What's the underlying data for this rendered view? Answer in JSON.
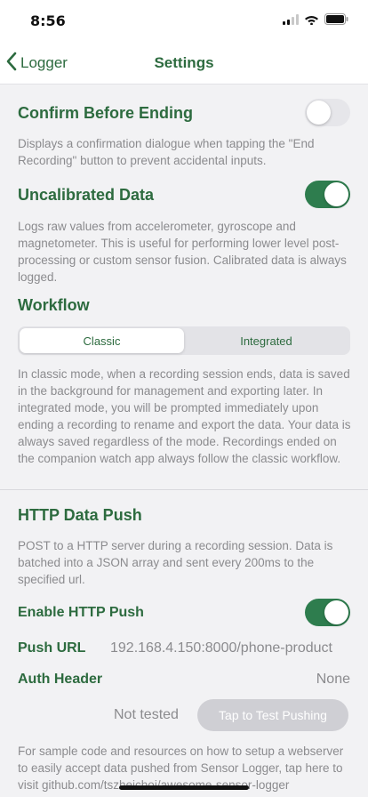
{
  "status_bar": {
    "time": "8:56"
  },
  "nav": {
    "back_label": "Logger",
    "title": "Settings"
  },
  "confirm": {
    "title": "Confirm Before Ending",
    "toggle_on": false,
    "description": "Displays a confirmation dialogue when tapping the \"End Recording\" button to prevent accidental inputs."
  },
  "uncalibrated": {
    "title": "Uncalibrated Data",
    "toggle_on": true,
    "description": "Logs raw values from accelerometer, gyroscope and magnetometer. This is useful for performing lower level post-processing or custom sensor fusion. Calibrated data is always logged."
  },
  "workflow": {
    "title": "Workflow",
    "options": [
      "Classic",
      "Integrated"
    ],
    "selected": "Classic",
    "description": "In classic mode, when a recording session ends, data is saved in the background for management and exporting later. In integrated mode, you will be prompted immediately upon ending a recording to rename and export the data. Your data is always saved regardless of the mode. Recordings ended on the companion watch app always follow the classic workflow."
  },
  "http_push": {
    "title": "HTTP Data Push",
    "description": "POST to a HTTP server during a recording session. Data is batched into a JSON array and sent every 200ms to the specified url.",
    "enable_label": "Enable HTTP Push",
    "enable_on": true,
    "push_url_label": "Push URL",
    "push_url_value": "192.168.4.150:8000/phone-product",
    "auth_label": "Auth Header",
    "auth_value": "None",
    "test_status": "Not tested",
    "test_button_label": "Tap to Test Pushing",
    "footer": "For sample code and resources on how to setup a webserver to easily accept data pushed from Sensor Logger, tap here to visit github.com/tszheichoi/awesome-sensor-logger"
  },
  "colors": {
    "accent": "#2d6b3f",
    "toggle_on": "#2e7d4e",
    "muted_text": "#8b8b8e",
    "background": "#f2f2f4"
  }
}
